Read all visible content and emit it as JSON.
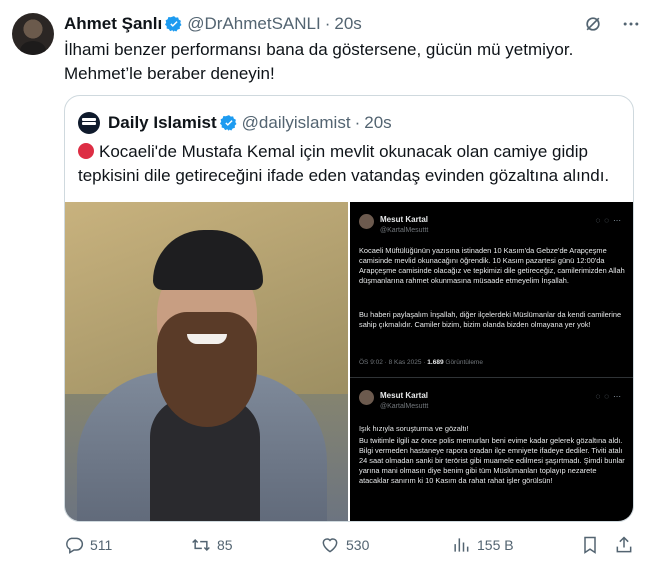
{
  "tweet": {
    "author_name": "Ahmet Şanlı",
    "author_handle": "@DrAhmetSANLI",
    "time": "20s",
    "text_line1": "İlhami benzer performansı bana da göstersene, gücün mü yetmiyor.",
    "text_line2": "Mehmet’le beraber deneyin!"
  },
  "quote": {
    "author_name": "Daily Islamist",
    "author_handle": "@dailyislamist",
    "time": "20s",
    "text_line1": "Kocaeli'de Mustafa Kemal için mevlit okunacak olan camiye gidip",
    "text_line2": "tepkisini dile getireceğini ifade eden vatandaş evinden gözaltına alındı.",
    "screenshot1": {
      "name": "Mesut Kartal",
      "handle": "@KartalMesuttt",
      "p1": "Kocaeli Müftülüğünün yazısına istinaden 10 Kasım'da Gebze'de Arapçeşme camisinde mevlid okunacağını öğrendik. 10 Kasım pazartesi günü 12:00'da Arapçeşme camisinde olacağız ve tepkimizi dile getireceğiz, camilerimizden Allah düşmanlarına rahmet okunmasına müsaade etmeyelim İnşallah.",
      "p2": "Bu haberi paylaşalım İnşallah, diğer ilçelerdeki Müslümanlar da kendi camilerine sahip çıkmalıdır. Camiler bizim, bizim olanda bizden olmayana yer yok!",
      "meta_time": "ÖS 9:02 · 8 Kas 2025 ·",
      "meta_views": "1.689",
      "meta_views_label": "Görüntüleme"
    },
    "screenshot2": {
      "name": "Mesut Kartal",
      "handle": "@KartalMesuttt",
      "p1": "Işık hızıyla soruşturma ve gözaltı!",
      "p2": "Bu twitimle ilgili az önce polis memurları beni evime kadar gelerek gözaltına aldı. Bilgi vermeden hastaneye rapora oradan ilçe emniyete ifadeye dediler. Tiviti atalı 24 saat olmadan sanki bir terörist gibi muamele edilmesi şaşırtmadı. Şimdi bunlar yarına mani olmasın diye benim gibi tüm Müslümanları toplayıp nezarete atacaklar sanırım ki 10 Kasım da rahat rahat işler görülsün!"
    }
  },
  "actions": {
    "replies": "511",
    "reposts": "85",
    "likes": "530",
    "views": "155 B"
  },
  "icons": {
    "verified": "verified-badge-icon",
    "grok": "grok-icon",
    "more": "more-icon",
    "reply": "reply-icon",
    "repost": "repost-icon",
    "like": "like-icon",
    "views": "views-icon",
    "bookmark": "bookmark-icon",
    "share": "share-icon"
  },
  "colors": {
    "accent": "#1d9bf0",
    "muted": "#536471",
    "border": "#cfd9de"
  }
}
